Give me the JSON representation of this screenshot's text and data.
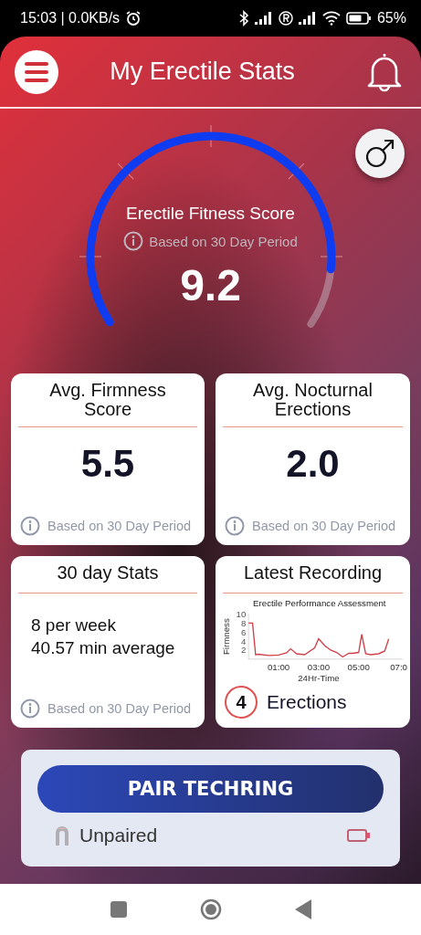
{
  "status_bar": {
    "time": "15:03 | 0.0KB/s",
    "battery": "65%"
  },
  "header": {
    "title": "My Erectile Stats"
  },
  "score": {
    "title": "Erectile Fitness Score",
    "note": "Based on 30 Day Period",
    "value": "9.2"
  },
  "stat_cards": [
    {
      "kind": "value",
      "title": "Avg. Firmness Score",
      "value": "5.5",
      "note": "Based on 30 Day Period"
    },
    {
      "kind": "value",
      "title": "Avg. Nocturnal Erections",
      "value": "2.0",
      "note": "Based on 30 Day Period"
    },
    {
      "kind": "lines",
      "title": "30 day Stats",
      "lines": [
        "8 per week",
        "40.57 min average"
      ],
      "note": "Based on 30 Day Period"
    },
    {
      "kind": "recording",
      "title": "Latest Recording",
      "count": "4",
      "count_label": "Erections",
      "chart_data": {
        "type": "line",
        "title": "Erectile Performance Assessment",
        "xlabel": "24Hr-Time",
        "ylabel": "Firmness",
        "x": [
          -0.5,
          -0.3,
          -0.15,
          0,
          0.5,
          1,
          1.4,
          1.6,
          1.9,
          2.3,
          2.8,
          3,
          3.3,
          3.6,
          3.9,
          4.2,
          4.5,
          4.7,
          5,
          5.15,
          5.35,
          5.6,
          6,
          6.3,
          6.5
        ],
        "series": [
          {
            "color": "#d0404a",
            "values": [
              8,
              8,
              1,
              1.1,
              0.8,
              0.9,
              1.4,
              2.3,
              1.2,
              1,
              2.5,
              4.5,
              3,
              2,
              1.5,
              0.5,
              1.3,
              1.3,
              1.5,
              5.5,
              1.2,
              1,
              1.2,
              1.8,
              4.5
            ]
          }
        ],
        "xlim": [
          -0.5,
          7.2
        ],
        "ylim": [
          0,
          10
        ],
        "xticks": [
          {
            "value": 1,
            "label": "01:00"
          },
          {
            "value": 3,
            "label": "03:00"
          },
          {
            "value": 5,
            "label": "05:00"
          },
          {
            "value": 7,
            "label": "07:0"
          }
        ],
        "yticks": [
          2,
          4,
          6,
          8,
          10
        ]
      }
    }
  ],
  "device": {
    "button": "PAIR TECHRING",
    "status": "Unpaired"
  }
}
